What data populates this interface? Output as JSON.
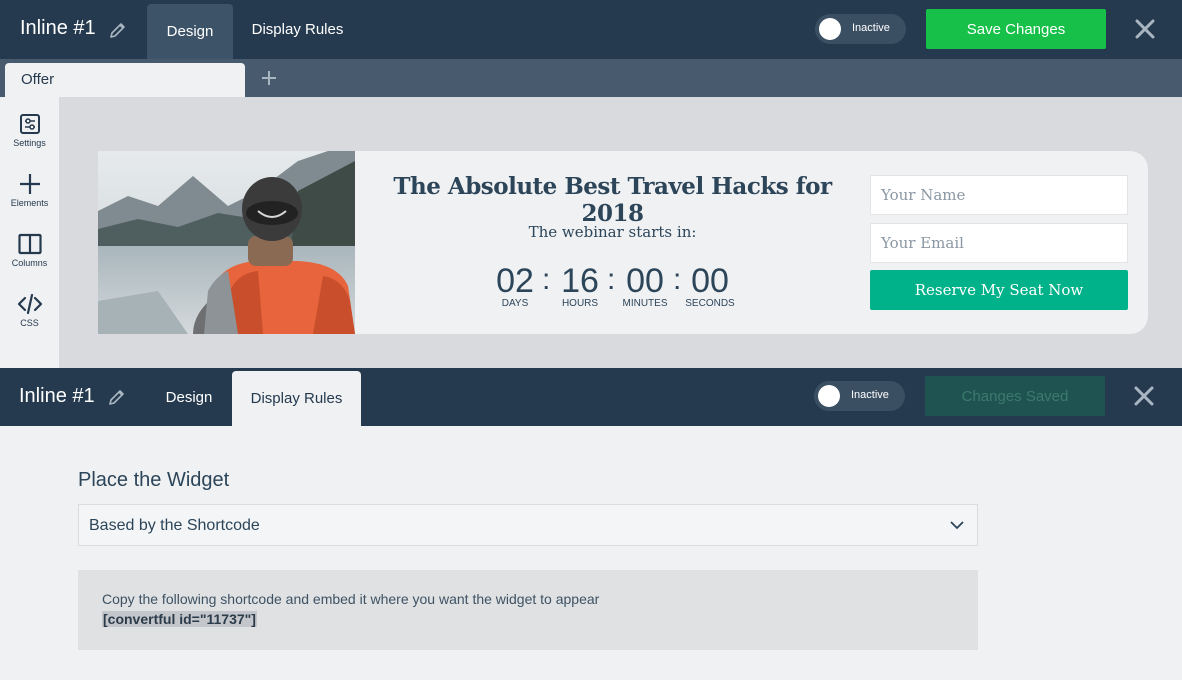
{
  "editor1": {
    "title": "Inline #1",
    "tabs": [
      {
        "label": "Design"
      },
      {
        "label": "Display Rules"
      }
    ],
    "toggle_label": "Inactive",
    "save_label": "Save Changes",
    "subtabs": [
      {
        "label": "Offer"
      }
    ],
    "sidebar": [
      {
        "label": "Settings",
        "icon": "settings-icon"
      },
      {
        "label": "Elements",
        "icon": "plus-icon"
      },
      {
        "label": "Columns",
        "icon": "columns-icon"
      },
      {
        "label": "CSS",
        "icon": "code-icon"
      }
    ],
    "widget": {
      "headline": "The Absolute Best Travel Hacks for 2018",
      "subheadline": "The webinar starts in:",
      "countdown": [
        {
          "value": "02",
          "label": "DAYS"
        },
        {
          "value": "16",
          "label": "HOURS"
        },
        {
          "value": "00",
          "label": "MINUTES"
        },
        {
          "value": "00",
          "label": "SECONDS"
        }
      ],
      "separator": ":",
      "name_placeholder": "Your Name",
      "email_placeholder": "Your Email",
      "cta_label": "Reserve My Seat Now"
    }
  },
  "editor2": {
    "title": "Inline #1",
    "tabs": [
      {
        "label": "Design"
      },
      {
        "label": "Display Rules"
      }
    ],
    "toggle_label": "Inactive",
    "save_label": "Changes Saved",
    "place_title": "Place the Widget",
    "place_select_value": "Based by the Shortcode",
    "shortcode_instruction": "Copy the following shortcode and embed it where you want the widget to appear",
    "shortcode": "[convertful id=\"11737\"]"
  },
  "colors": {
    "topbar": "#253a4e",
    "save_green": "#16c049",
    "cta_teal": "#00b28a",
    "text_dark": "#2c4559"
  }
}
